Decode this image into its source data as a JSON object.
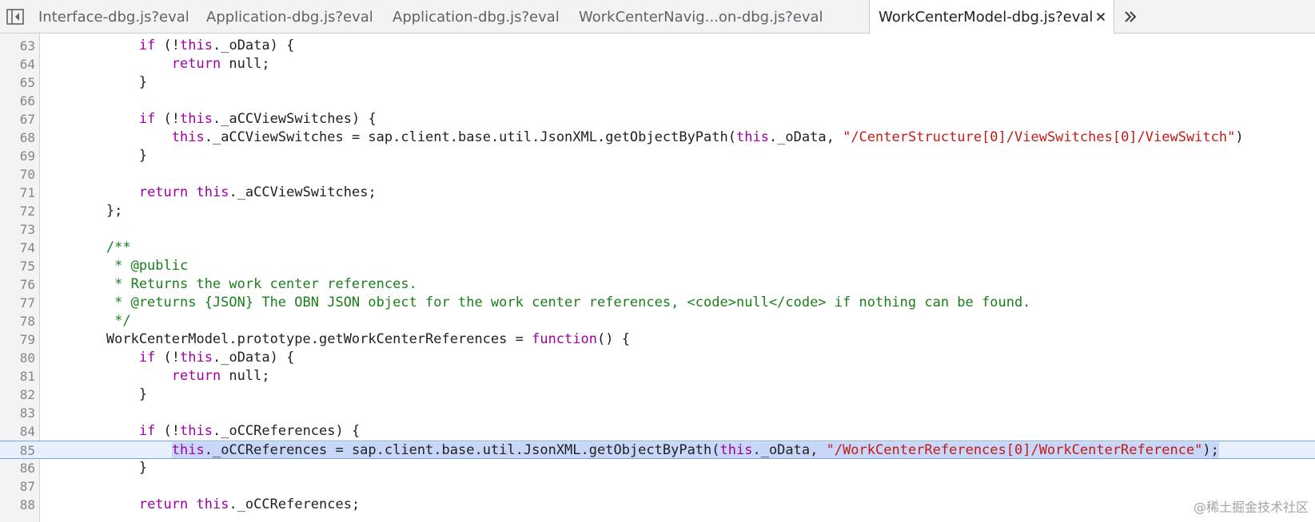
{
  "tabs": [
    {
      "label": "Interface-dbg.js?eval",
      "active": false
    },
    {
      "label": "Application-dbg.js?eval",
      "active": false
    },
    {
      "label": "Application-dbg.js?eval",
      "active": false
    },
    {
      "label": "WorkCenterNavig...on-dbg.js?eval",
      "active": false
    },
    {
      "label": "WorkCenterModel-dbg.js?eval",
      "active": true
    }
  ],
  "tab_close_icon": "close-icon",
  "more_tabs_icon": "double-chevron-right-icon",
  "navigator_toggle_icon": "sidebar-toggle-icon",
  "editor": {
    "current_line": 85,
    "lines": [
      {
        "n": "63",
        "tokens": [
          {
            "t": "            ",
            "c": "p"
          },
          {
            "t": "if",
            "c": "kw"
          },
          {
            "t": " (!",
            "c": "p"
          },
          {
            "t": "this",
            "c": "kw"
          },
          {
            "t": "._oData) {",
            "c": "p"
          }
        ]
      },
      {
        "n": "64",
        "tokens": [
          {
            "t": "                ",
            "c": "p"
          },
          {
            "t": "return",
            "c": "kw"
          },
          {
            "t": " null;",
            "c": "p"
          }
        ]
      },
      {
        "n": "65",
        "tokens": [
          {
            "t": "            }",
            "c": "p"
          }
        ]
      },
      {
        "n": "66",
        "tokens": []
      },
      {
        "n": "67",
        "tokens": [
          {
            "t": "            ",
            "c": "p"
          },
          {
            "t": "if",
            "c": "kw"
          },
          {
            "t": " (!",
            "c": "p"
          },
          {
            "t": "this",
            "c": "kw"
          },
          {
            "t": "._aCCViewSwitches) {",
            "c": "p"
          }
        ]
      },
      {
        "n": "68",
        "tokens": [
          {
            "t": "                ",
            "c": "p"
          },
          {
            "t": "this",
            "c": "kw"
          },
          {
            "t": "._aCCViewSwitches = sap.client.base.util.JsonXML.getObjectByPath(",
            "c": "p"
          },
          {
            "t": "this",
            "c": "kw"
          },
          {
            "t": "._oData, ",
            "c": "p"
          },
          {
            "t": "\"/CenterStructure[0]/ViewSwitches[0]/ViewSwitch\"",
            "c": "str"
          },
          {
            "t": ")",
            "c": "p"
          }
        ]
      },
      {
        "n": "69",
        "tokens": [
          {
            "t": "            }",
            "c": "p"
          }
        ]
      },
      {
        "n": "70",
        "tokens": []
      },
      {
        "n": "71",
        "tokens": [
          {
            "t": "            ",
            "c": "p"
          },
          {
            "t": "return",
            "c": "kw"
          },
          {
            "t": " ",
            "c": "p"
          },
          {
            "t": "this",
            "c": "kw"
          },
          {
            "t": "._aCCViewSwitches;",
            "c": "p"
          }
        ]
      },
      {
        "n": "72",
        "tokens": [
          {
            "t": "        };",
            "c": "p"
          }
        ]
      },
      {
        "n": "73",
        "tokens": []
      },
      {
        "n": "74",
        "tokens": [
          {
            "t": "        /**",
            "c": "com"
          }
        ]
      },
      {
        "n": "75",
        "tokens": [
          {
            "t": "         * @public",
            "c": "com"
          }
        ]
      },
      {
        "n": "76",
        "tokens": [
          {
            "t": "         * Returns the work center references.",
            "c": "com"
          }
        ]
      },
      {
        "n": "77",
        "tokens": [
          {
            "t": "         * @returns {JSON} The OBN JSON object for the work center references, <code>null</code> if nothing can be found.",
            "c": "com"
          }
        ]
      },
      {
        "n": "78",
        "tokens": [
          {
            "t": "         */",
            "c": "com"
          }
        ]
      },
      {
        "n": "79",
        "tokens": [
          {
            "t": "        WorkCenterModel.prototype.getWorkCenterReferences = ",
            "c": "p"
          },
          {
            "t": "function",
            "c": "kw"
          },
          {
            "t": "() {",
            "c": "p"
          }
        ]
      },
      {
        "n": "80",
        "tokens": [
          {
            "t": "            ",
            "c": "p"
          },
          {
            "t": "if",
            "c": "kw"
          },
          {
            "t": " (!",
            "c": "p"
          },
          {
            "t": "this",
            "c": "kw"
          },
          {
            "t": "._oData) {",
            "c": "p"
          }
        ]
      },
      {
        "n": "81",
        "tokens": [
          {
            "t": "                ",
            "c": "p"
          },
          {
            "t": "return",
            "c": "kw"
          },
          {
            "t": " null;",
            "c": "p"
          }
        ]
      },
      {
        "n": "82",
        "tokens": [
          {
            "t": "            }",
            "c": "p"
          }
        ]
      },
      {
        "n": "83",
        "tokens": []
      },
      {
        "n": "84",
        "tokens": [
          {
            "t": "            ",
            "c": "p"
          },
          {
            "t": "if",
            "c": "kw"
          },
          {
            "t": " (!",
            "c": "p"
          },
          {
            "t": "this",
            "c": "kw"
          },
          {
            "t": "._oCCReferences) {",
            "c": "p"
          }
        ]
      },
      {
        "n": "85",
        "tokens": [
          {
            "t": "                ",
            "c": "p"
          },
          {
            "t": "this",
            "c": "kw sel"
          },
          {
            "t": "._oCCReferences = sap.client.base.util.JsonXML.getObjectByPath(",
            "c": "p sel"
          },
          {
            "t": "this",
            "c": "kw sel"
          },
          {
            "t": "._oData, ",
            "c": "p sel"
          },
          {
            "t": "\"/WorkCenterReferences[0]/WorkCenterReference\"",
            "c": "str sel"
          },
          {
            "t": ");",
            "c": "p sel"
          }
        ]
      },
      {
        "n": "86",
        "tokens": [
          {
            "t": "            }",
            "c": "p"
          }
        ]
      },
      {
        "n": "87",
        "tokens": []
      },
      {
        "n": "88",
        "tokens": [
          {
            "t": "            ",
            "c": "p"
          },
          {
            "t": "return",
            "c": "kw"
          },
          {
            "t": " ",
            "c": "p"
          },
          {
            "t": "this",
            "c": "kw"
          },
          {
            "t": "._oCCReferences;",
            "c": "p"
          }
        ]
      }
    ]
  },
  "watermark": "@稀土掘金技术社区"
}
